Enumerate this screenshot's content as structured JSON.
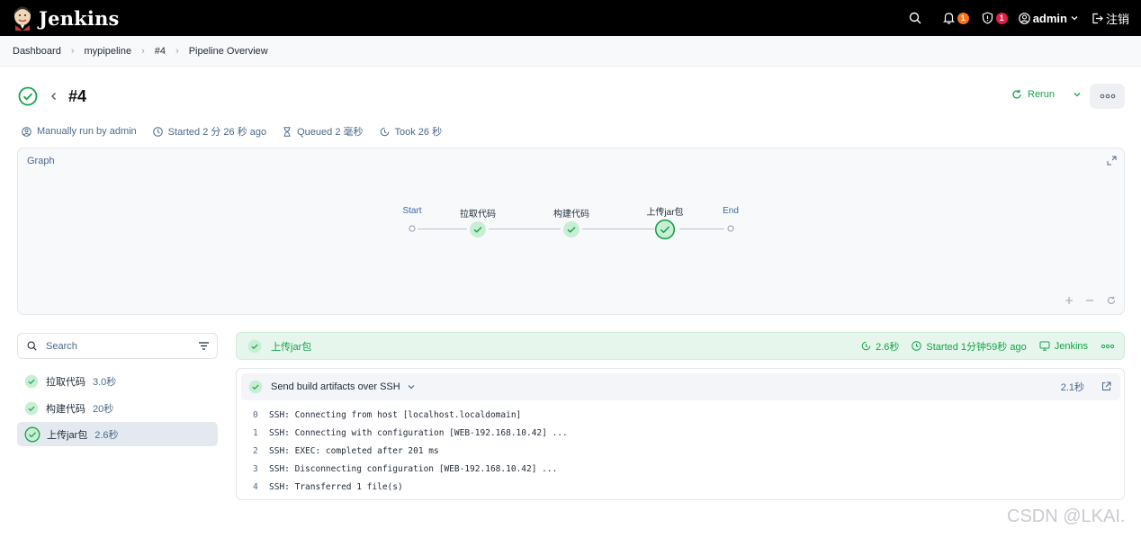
{
  "app": {
    "name": "Jenkins"
  },
  "topbar": {
    "notifications_count": "1",
    "security_count": "1",
    "user": "admin",
    "logout": "注销"
  },
  "breadcrumb": [
    "Dashboard",
    "mypipeline",
    "#4",
    "Pipeline Overview"
  ],
  "run": {
    "title": "#4",
    "rerun": "Rerun",
    "meta": {
      "trigger": "Manually run by admin",
      "started": "Started 2 分 26 秒 ago",
      "queued": "Queued 2 毫秒",
      "took": "Took 26 秒"
    }
  },
  "graph": {
    "label": "Graph",
    "nodes": [
      "Start",
      "拉取代码",
      "构建代码",
      "上传jar包",
      "End"
    ]
  },
  "sidebar": {
    "search_placeholder": "Search",
    "stages": [
      {
        "name": "拉取代码",
        "duration": "3.0秒"
      },
      {
        "name": "构建代码",
        "duration": "20秒"
      },
      {
        "name": "上传jar包",
        "duration": "2.6秒"
      }
    ]
  },
  "detail": {
    "stage_name": "上传jar包",
    "duration": "2.6秒",
    "started": "Started 1分钟59秒 ago",
    "agent": "Jenkins",
    "step": {
      "title": "Send build artifacts over SSH",
      "duration": "2.1秒",
      "log": [
        {
          "n": "0",
          "text": "SSH: Connecting from host [localhost.localdomain]"
        },
        {
          "n": "1",
          "text": "SSH: Connecting with configuration [WEB-192.168.10.42] ..."
        },
        {
          "n": "2",
          "text": "SSH: EXEC: completed after 201 ms"
        },
        {
          "n": "3",
          "text": "SSH: Disconnecting configuration [WEB-192.168.10.42] ..."
        },
        {
          "n": "4",
          "text": "SSH: Transferred 1 file(s)"
        }
      ]
    }
  },
  "watermark": "CSDN @LKAI.",
  "colors": {
    "success": "#16a34a",
    "topbar": "#000000",
    "meta_text": "#4b6a8a"
  }
}
